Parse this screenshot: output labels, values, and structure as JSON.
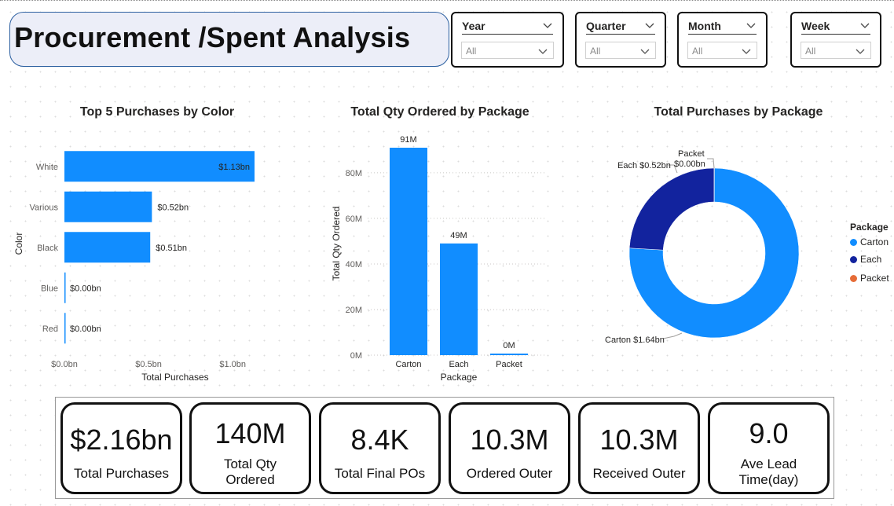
{
  "header": {
    "title": "Procurement /Spent Analysis"
  },
  "slicers": [
    {
      "label": "Year",
      "value": "All"
    },
    {
      "label": "Quarter",
      "value": "All"
    },
    {
      "label": "Month",
      "value": "All"
    },
    {
      "label": "Week",
      "value": "All"
    }
  ],
  "colors": {
    "primary": "#118dff",
    "dark_blue": "#12239e",
    "orange": "#e66c37",
    "title_bg": "#eceef8"
  },
  "chart_data": [
    {
      "type": "bar",
      "orientation": "horizontal",
      "title": "Top 5 Purchases by Color",
      "xlabel": "Total Purchases",
      "ylabel": "Color",
      "categories": [
        "White",
        "Various",
        "Black",
        "Blue",
        "Red"
      ],
      "values": [
        1.13,
        0.52,
        0.51,
        0.0,
        0.0
      ],
      "data_labels": [
        "$1.13bn",
        "$0.52bn",
        "$0.51bn",
        "$0.00bn",
        "$0.00bn"
      ],
      "xticks": [
        "$0.0bn",
        "$0.5bn",
        "$1.0bn"
      ],
      "xlim": [
        0,
        1.13
      ],
      "grid": false
    },
    {
      "type": "bar",
      "title": "Total Qty Ordered by Package",
      "xlabel": "Package",
      "ylabel": "Total Qty Ordered",
      "categories": [
        "Carton",
        "Each",
        "Packet"
      ],
      "values": [
        91,
        49,
        0.4
      ],
      "data_labels": [
        "91M",
        "49M",
        "0M"
      ],
      "yticks": [
        "0M",
        "20M",
        "40M",
        "60M",
        "80M"
      ],
      "ylim": [
        0,
        91
      ],
      "grid": true
    },
    {
      "type": "pie",
      "variant": "donut",
      "title": "Total Purchases by Package",
      "legend_title": "Package",
      "legend_position": "right",
      "slices": [
        {
          "name": "Carton",
          "value": 1.64,
          "label": "Carton $1.64bn",
          "color": "#118dff"
        },
        {
          "name": "Each",
          "value": 0.52,
          "label": "Each $0.52bn",
          "color": "#12239e"
        },
        {
          "name": "Packet",
          "value": 0.0,
          "label_line1": "Packet",
          "label_line2": "$0.00bn",
          "color": "#e66c37"
        }
      ]
    }
  ],
  "kpis": [
    {
      "value": "$2.16bn",
      "label": "Total Purchases"
    },
    {
      "value": "140M",
      "label_line1": "Total Qty",
      "label_line2": "Ordered"
    },
    {
      "value": "8.4K",
      "label": "Total Final POs"
    },
    {
      "value": "10.3M",
      "label": "Ordered Outer"
    },
    {
      "value": "10.3M",
      "label": "Received Outer"
    },
    {
      "value": "9.0",
      "label_line1": "Ave Lead",
      "label_line2": "Time(day)"
    }
  ]
}
